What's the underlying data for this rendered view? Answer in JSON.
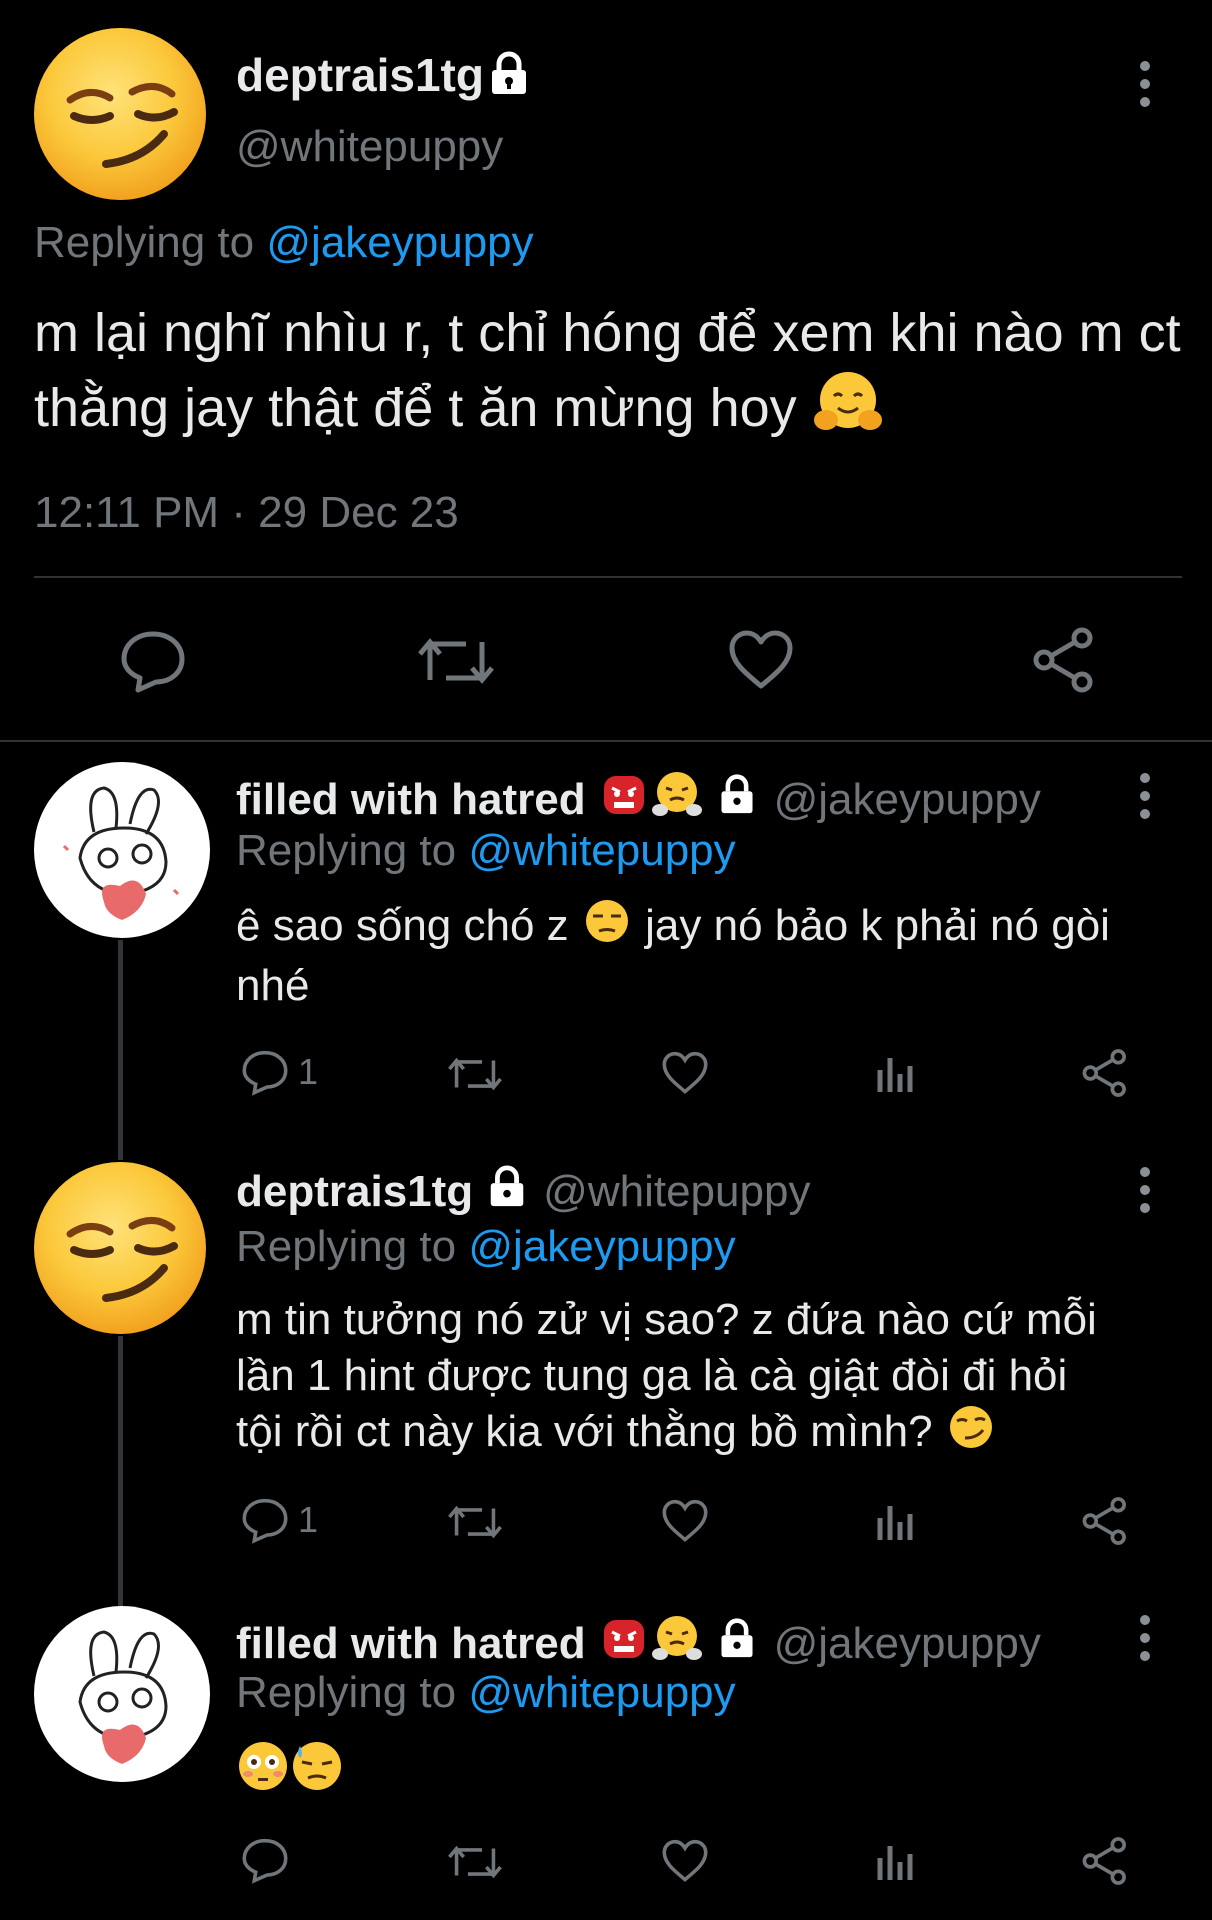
{
  "main_tweet": {
    "display_name": "deptrais1tg",
    "handle": "@whitepuppy",
    "replying_prefix": "Replying to",
    "replying_to": "@jakeypuppy",
    "text": "m lại nghĩ nhìu r, t chỉ hóng để xem khi nào m ct thằng jay thật để t ăn mừng hoy",
    "timestamp": "12:11 PM · 29 Dec 23"
  },
  "replies": [
    {
      "display_name": "filled with hatred",
      "handle": "@jakeypuppy",
      "replying_prefix": "Replying to",
      "replying_to": "@whitepuppy",
      "text_a": "ê sao sống chó z",
      "text_b": "jay nó bảo k phải nó gòi",
      "text_c": "nhé",
      "reply_count": "1"
    },
    {
      "display_name": "deptrais1tg",
      "handle": "@whitepuppy",
      "replying_prefix": "Replying to",
      "replying_to": "@jakeypuppy",
      "line1": "m tin tưởng nó zử vị sao? z đứa nào cứ mỗi",
      "line2": "lần 1 hint được tung ga là cà giật đòi đi hỏi",
      "line3": "tội rồi ct này kia với thằng bồ mình?",
      "reply_count": "1"
    },
    {
      "display_name": "filled with hatred",
      "handle": "@jakeypuppy",
      "replying_prefix": "Replying to",
      "replying_to": "@whitepuppy"
    }
  ],
  "icons": [
    "more-vertical-icon",
    "lock-icon",
    "reply-icon",
    "retweet-icon",
    "like-icon",
    "share-icon",
    "views-icon"
  ],
  "colors": {
    "background": "#000000",
    "link": "#1d9bf0",
    "muted": "#71767b",
    "text": "#e7e9ea"
  }
}
